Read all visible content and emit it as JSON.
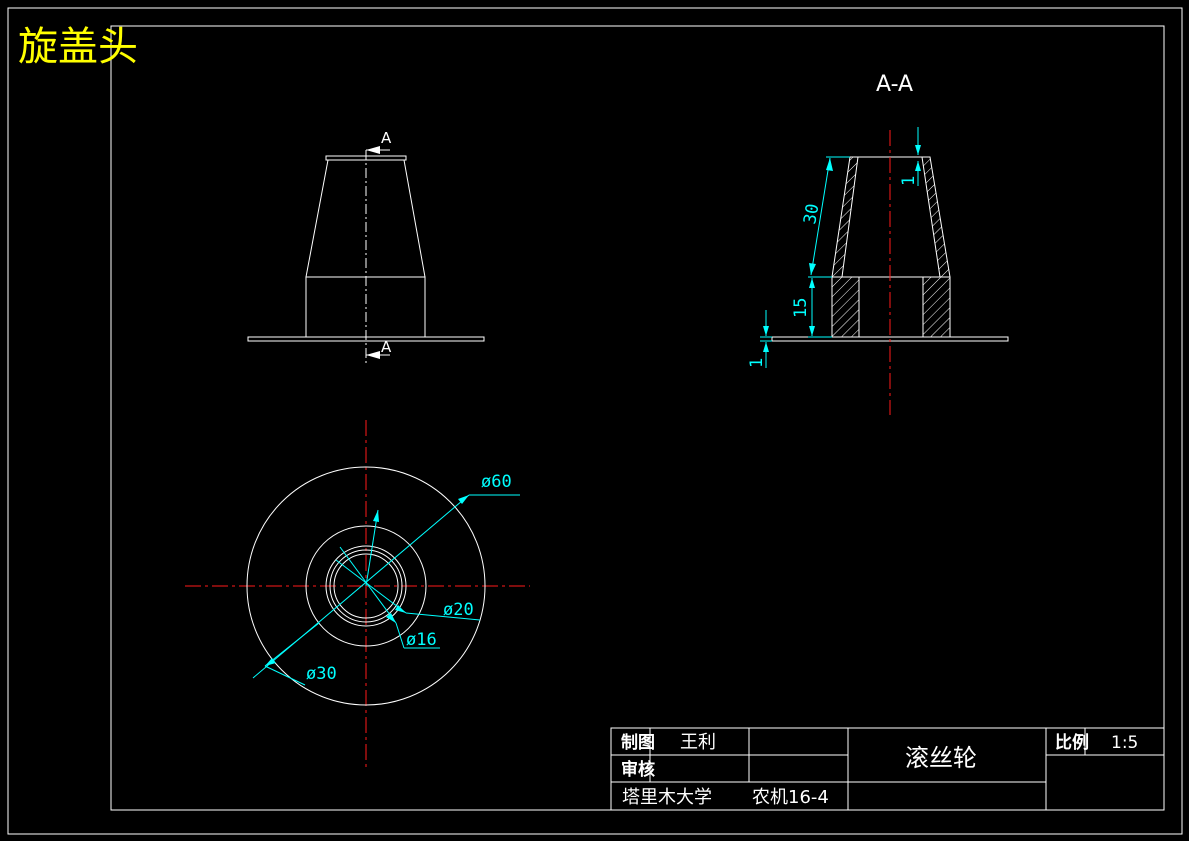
{
  "title": "旋盖头",
  "colors": {
    "background": "#000000",
    "title": "#ffff00",
    "lines": "#ffffff",
    "centerline": "#ff1a1a",
    "dimension": "#00ffff"
  },
  "section_label": "A-A",
  "cut_markers": {
    "top": "A",
    "bottom": "A"
  },
  "dimensions": {
    "d60": "ø60",
    "d20": "ø20",
    "d16": "ø16",
    "d30": "ø30",
    "h30": "30",
    "h15": "15",
    "t1_top": "1",
    "t1_bottom": "1"
  },
  "title_block": {
    "label_draw": "制图",
    "label_check": "审核",
    "drawer": "王利",
    "part_name": "滚丝轮",
    "label_scale": "比例",
    "scale": "1:5",
    "school": "塔里木大学",
    "class": "农机16-4"
  }
}
